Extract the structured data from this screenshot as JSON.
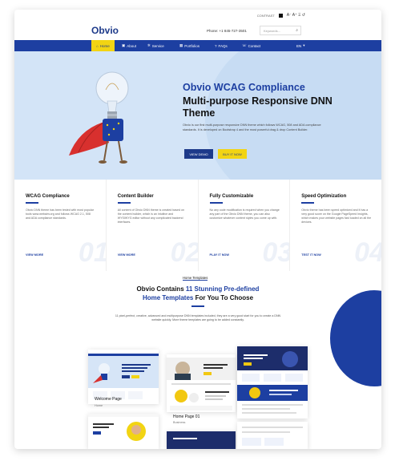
{
  "topbar": {
    "contrast_label": "CONTRAST",
    "font_controls": "A⁻ A⁺ Ξ ↺"
  },
  "header": {
    "logo": "Obvio",
    "phone": "Phone: +1 845-727-3501",
    "search_placeholder": "Keywords..."
  },
  "nav": {
    "items": [
      {
        "label": "Home",
        "icon": "home-icon"
      },
      {
        "label": "About",
        "icon": "info-icon"
      },
      {
        "label": "Service",
        "icon": "gear-icon"
      },
      {
        "label": "Portfolios",
        "icon": "grid-icon"
      },
      {
        "label": "FAQs",
        "icon": "question-icon"
      },
      {
        "label": "Contact",
        "icon": "phone-icon"
      }
    ],
    "language": "EN"
  },
  "hero": {
    "title_line1": "Obvio WCAG Compliance",
    "title_line2": "Multi-purpose Responsive DNN Theme",
    "text": "Obvio is our first multi-purpose responsive DNN theme which follows WCAG, 508 and ADA compliance standards. It is developed on Bootstrap 4 and the most powerful drag & drop Content Builder.",
    "btn_demo": "VIEW DEMO",
    "btn_buy": "BUY IT NOW"
  },
  "features": [
    {
      "title": "WCAG Compliance",
      "text": "Obvio DNN theme has been tested with most popular tools www.webaim.org and follows WCAG 2.1, 508 and ADA compliance standards.",
      "link": "VIEW MORE",
      "number": "01"
    },
    {
      "title": "Content Builder",
      "text": "All content of Obvio DNN theme is created based on the content builder, which is an intuitive and WYSIWYG editor without any complicated backend interfaces.",
      "link": "VIEW MORE",
      "number": "02"
    },
    {
      "title": "Fully Customizable",
      "text": "No any code modification is required when you change any part of the Obvio DNN theme, you can also customize whatever content styles you come up with.",
      "link": "PLAY IT NOW",
      "number": "03"
    },
    {
      "title": "Speed Optimization",
      "text": "Obvio theme has been speed optimized and it has a very good score on the Google PageSpeed Insights, which makes your website pages fast loaded on all the devices.",
      "link": "TEST IT NOW",
      "number": "04"
    }
  ],
  "templates": {
    "tag": "Home Templates",
    "heading_pre": "Obvio Contains ",
    "heading_highlight": "11 Stunning Pre-defined",
    "heading_line2_highlight": "Home Templates",
    "heading_line2_post": " For You To Choose",
    "text": "11 pixel-perfect, creative, advanced and multipurpose DNN templates included, they are a very good start for you to create a DNN website quickly. More theme templates are going to be added constantly.",
    "cards": [
      {
        "label": "Welcome Page",
        "sub": "Home",
        "mini_title": "Creative Ideas And Solutions To Help Your Brand Grows"
      },
      {
        "label": "Home Page 01",
        "sub": "Business"
      }
    ]
  }
}
